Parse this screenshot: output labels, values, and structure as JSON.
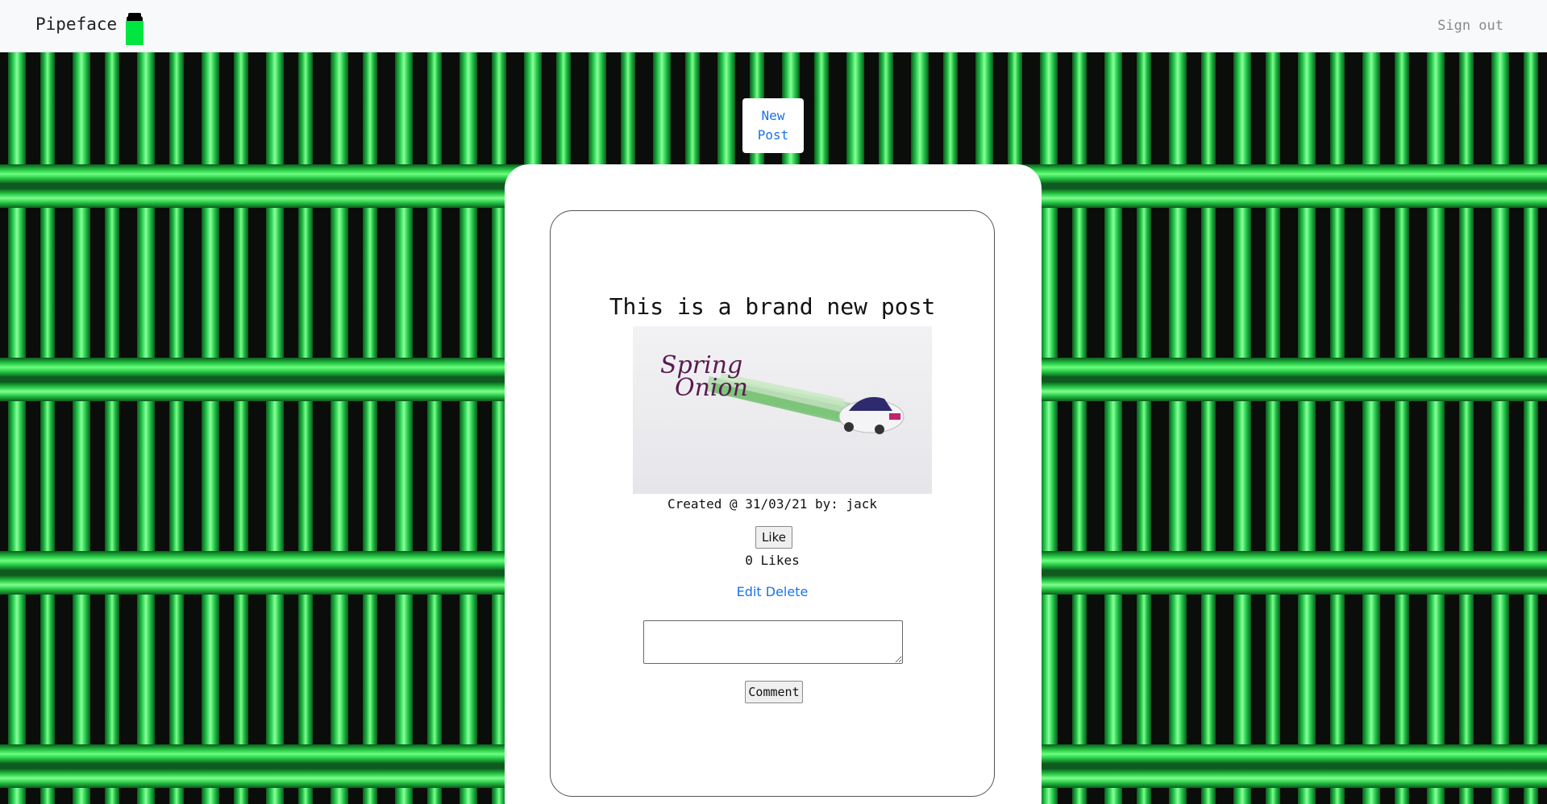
{
  "navbar": {
    "brand": "Pipeface",
    "logo_icon": "green-pipe-icon",
    "sign_out": "Sign out"
  },
  "toolbar": {
    "new_post_label": "New Post"
  },
  "post": {
    "title": "This is a brand new post",
    "image_text_line1": "Spring",
    "image_text_line2": "Onion",
    "meta": "Created @ 31/03/21 by: jack",
    "like_label": "Like",
    "likes_count": "0 Likes",
    "edit_label": "Edit",
    "delete_label": "Delete"
  },
  "comment": {
    "value": "",
    "button_label": "Comment"
  },
  "colors": {
    "link": "#1a73e8",
    "pipe_green": "#1fbf3f",
    "logo_green": "#00e640"
  }
}
